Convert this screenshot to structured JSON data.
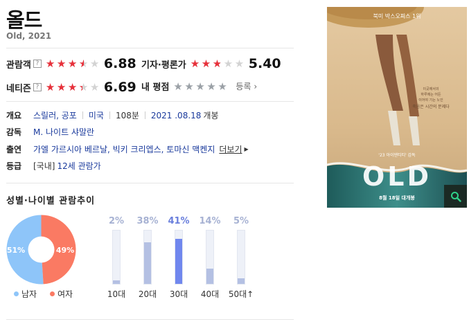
{
  "movie": {
    "title": "올드",
    "subtitle": "Old, 2021"
  },
  "ratings": {
    "audience": {
      "label": "관람객",
      "help": "?",
      "score": "6.88",
      "stars": 3.44
    },
    "critic": {
      "label": "기자·평론가",
      "score": "5.40",
      "stars": 2.7
    },
    "netizen": {
      "label": "네티즌",
      "help": "?",
      "score": "6.69",
      "stars": 3.35
    },
    "my": {
      "label": "내 평점",
      "register_label": "등록",
      "stars": 0
    }
  },
  "info": {
    "overview": {
      "key": "개요",
      "genre": "스릴러, 공포",
      "country": "미국",
      "runtime": "108분",
      "release_date": "2021 .08.18",
      "release_suffix": "개봉"
    },
    "director": {
      "key": "감독",
      "name": "M. 나이트 샤말란"
    },
    "cast": {
      "key": "출연",
      "names": "가엘 가르시아 베르날, 빅키 크리엡스, 토마신 맥켄지",
      "more_label": "더보기"
    },
    "rating": {
      "key": "등급",
      "region": "[국내]",
      "value": "12세 관람가"
    }
  },
  "stats": {
    "title": "성별·나이별 관람추이",
    "gender": {
      "male": {
        "label": "남자",
        "percent": 51,
        "display": "51%",
        "color": "#8ec5f9"
      },
      "female": {
        "label": "여자",
        "percent": 49,
        "display": "49%",
        "color": "#fa7a63"
      }
    },
    "ages": [
      {
        "label": "10대",
        "percent": 2,
        "display": "2%"
      },
      {
        "label": "20대",
        "percent": 38,
        "display": "38%"
      },
      {
        "label": "30대",
        "percent": 41,
        "display": "41%",
        "highlight": true
      },
      {
        "label": "40대",
        "percent": 14,
        "display": "14%"
      },
      {
        "label": "50대↑",
        "percent": 5,
        "display": "5%"
      }
    ]
  },
  "poster": {
    "top_text": "북미 박스오피스 1위",
    "tagline_lines": [
      "이곳에서의",
      "하루에는 어든",
      "이어야 기는 노인",
      "죽음은 시간의 문제다"
    ],
    "director_credit": "'23 아이덴티티' 감독",
    "logo": "OLD",
    "release_line": "8월 18일 대개봉"
  },
  "colors": {
    "accent_red": "#e8303a",
    "link_blue": "#1a3a9c",
    "search_bg": "#1b2a24"
  }
}
